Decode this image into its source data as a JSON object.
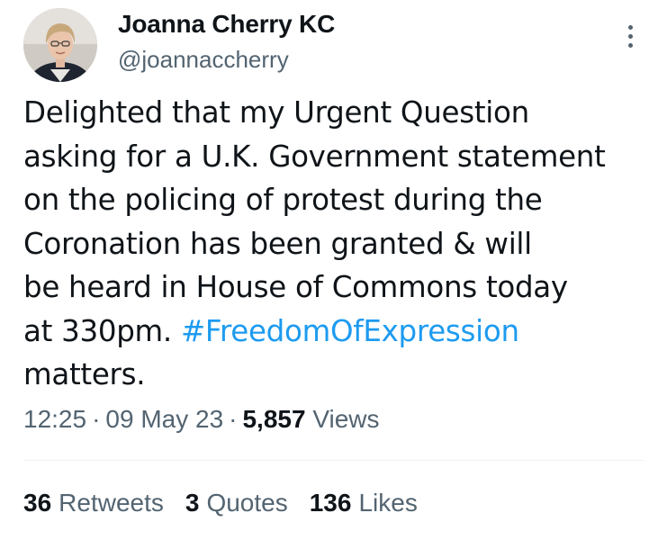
{
  "author": {
    "name": "Joanna Cherry KC",
    "handle": "@joannaccherry"
  },
  "tweet": {
    "lines": [
      "Delighted that my Urgent Question",
      "asking for a U.K. Government statement",
      "on the policing of protest during the",
      "Coronation has been granted & will",
      "be heard in House of Commons today"
    ],
    "line6_text": "at 330pm. ",
    "hashtag": "#FreedomOfExpression",
    "line7": "matters."
  },
  "meta": {
    "time": "12:25",
    "separator": "·",
    "date": "09 May 23",
    "views_count": "5,857",
    "views_label": "Views"
  },
  "stats": {
    "retweets_count": "36",
    "retweets_label": "Retweets",
    "quotes_count": "3",
    "quotes_label": "Quotes",
    "likes_count": "136",
    "likes_label": "Likes"
  },
  "colors": {
    "hashtag": "#1d9bf0",
    "secondary_text": "#536471",
    "primary_text": "#0f1419"
  },
  "icons": {
    "more": "more-vertical-icon"
  }
}
